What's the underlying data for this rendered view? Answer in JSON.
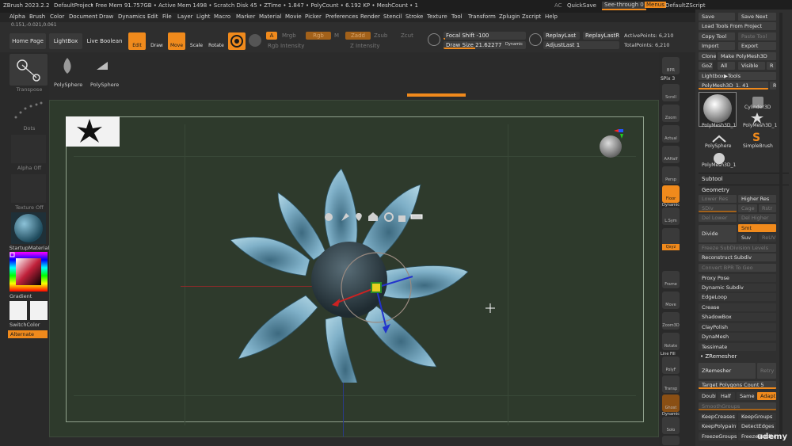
{
  "title_bar": {
    "app": "ZBrush 2023.2.2",
    "project": "DefaultProject",
    "stats": "• Free Mem 91.757GB • Active Mem 1498 • Scratch Disk 45 • ZTime • 1.847 • PolyCount • 6.192 KP • MeshCount • 1",
    "ac": "AC",
    "quicksave": "QuickSave",
    "see_through": "See-through 0",
    "menus": "Menus",
    "script": "DefaultZScript"
  },
  "menu": [
    "Alpha",
    "Brush",
    "Color",
    "Document",
    "Draw",
    "Dynamics",
    "Edit",
    "File",
    "Layer",
    "Light",
    "Macro",
    "Marker",
    "Material",
    "Movie",
    "Picker",
    "Preferences",
    "Render",
    "Stencil",
    "Stroke",
    "Texture",
    "Tool",
    "Transform",
    "Zplugin",
    "Zscript",
    "Help"
  ],
  "coords": "0.151,-0.021,0.061",
  "toolbar": {
    "home_page": "Home Page",
    "lightbox": "LightBox",
    "live_boolean": "Live Boolean",
    "edit": "Edit",
    "draw": "Draw",
    "move": "Move",
    "scale": "Scale",
    "rotate": "Rotate",
    "a": "A",
    "mrgb": "Mrgb",
    "rgb": "Rgb",
    "m": "M",
    "zadd": "Zadd",
    "zsub": "Zsub",
    "zcut": "Zcut",
    "rgb_intensity": "Rgb Intensity",
    "z_intensity": "Z Intensity",
    "focal_shift": "Focal Shift -100",
    "draw_size": "Draw Size 21.62277",
    "dynamic": "Dynamic",
    "replay_last": "ReplayLast",
    "replay_last_rel": "ReplayLastRel",
    "adjust_last": "AdjustLast 1",
    "active_points": "ActivePoints: 6,210",
    "total_points": "TotalPoints: 6,210"
  },
  "tool_shelf": {
    "transpose": "Transpose",
    "tool1": "PolySphere",
    "tool2": "PolySphere"
  },
  "left_tray": {
    "dots": "Dots",
    "alpha_off": "Alpha Off",
    "texture_off": "Texture Off",
    "material": "StartupMaterial",
    "gradient": "Gradient",
    "switch_color": "SwitchColor",
    "alternate": "Alternate"
  },
  "right_shelf": {
    "bpr": "BPR",
    "spix": "SPix 3",
    "scroll": "Scroll",
    "zoom": "Zoom",
    "actual": "Actual",
    "aahalf": "AAHalf",
    "persp": "Persp",
    "floor": "Floor",
    "dynamic_label": "Dynamic",
    "lsym": "L.Sym",
    "xyz": "Qxyz",
    "frame": "Frame",
    "move": "Move",
    "zoom3d": "Zoom3D",
    "rotate": "Rotate",
    "line_fill": "Line Fill",
    "polyf": "PolyF",
    "transp": "Transp",
    "ghost": "Ghost",
    "solo": "Solo",
    "dynamic2": "Dynamic"
  },
  "right_panel": {
    "save": "Save",
    "save_next": "Save Next",
    "load_tools": "Load Tools From Project",
    "copy_tool": "Copy Tool",
    "paste_tool": "Paste Tool",
    "import": "Import",
    "export": "Export",
    "clone": "Clone",
    "make_polymesh": "Make PolyMesh3D",
    "goz": "GoZ",
    "all": "All",
    "visible": "Visible",
    "r": "R",
    "lightbox_tools": "Lightbox▶Tools",
    "polymesh_slider": "PolyMesh3D_1. 41",
    "tool_polymesh_1": "PolyMesh3D_1",
    "tool_cylinder": "Cylinder3D",
    "tool_polymesh_2": "PolyMesh3D_1",
    "tool_polysphere": "PolySphere",
    "tool_simplebrush": "SimpleBrush",
    "tool_polymesh_3": "PolyMesh3D_1",
    "subtool": "Subtool",
    "geometry": "Geometry",
    "lower_res": "Lower Res",
    "higher_res": "Higher Res",
    "sdiv": "SDiv",
    "cage": "Cage",
    "rstr": "Rstr",
    "del_lower": "Del Lower",
    "del_higher": "Del Higher",
    "divide": "Divide",
    "smt": "Smt",
    "suv": "Suv",
    "reuv": "ReUV",
    "freeze_subdiv": "Freeze SubDivision Levels",
    "reconstruct_subdiv": "Reconstruct Subdiv",
    "convert_bpr": "Convert BPR To Geo",
    "proxy_pose": "Proxy Pose",
    "dynamic_subdiv": "Dynamic Subdiv",
    "edgeloop": "EdgeLoop",
    "crease": "Crease",
    "shadowbox": "ShadowBox",
    "claypolish": "ClayPolish",
    "dynamesh": "DynaMesh",
    "tessimate": "Tessimate",
    "zremesher_header": "ZRemesher",
    "zremesher_btn": "ZRemesher",
    "retry": "Retry",
    "target_polygons": "Target Polygons Count 5",
    "double": "Double",
    "half": "Half",
    "same": "Same",
    "adapt": "Adapt",
    "smooth_groups": "SmoothGroups",
    "keep_creases": "KeepCreases",
    "keep_groups": "KeepGroups",
    "keep_polypaint": "KeepPolypaint",
    "detect_edges": "DetectEdges",
    "freeze_groups": "FreezeGroups",
    "freeze_border": "FreezeBorder"
  },
  "watermark": "udemy",
  "colors": {
    "accent": "#f08a1c",
    "canvas": "#2e3a2c",
    "petal": "#7fb0c8",
    "panel": "#303030"
  }
}
